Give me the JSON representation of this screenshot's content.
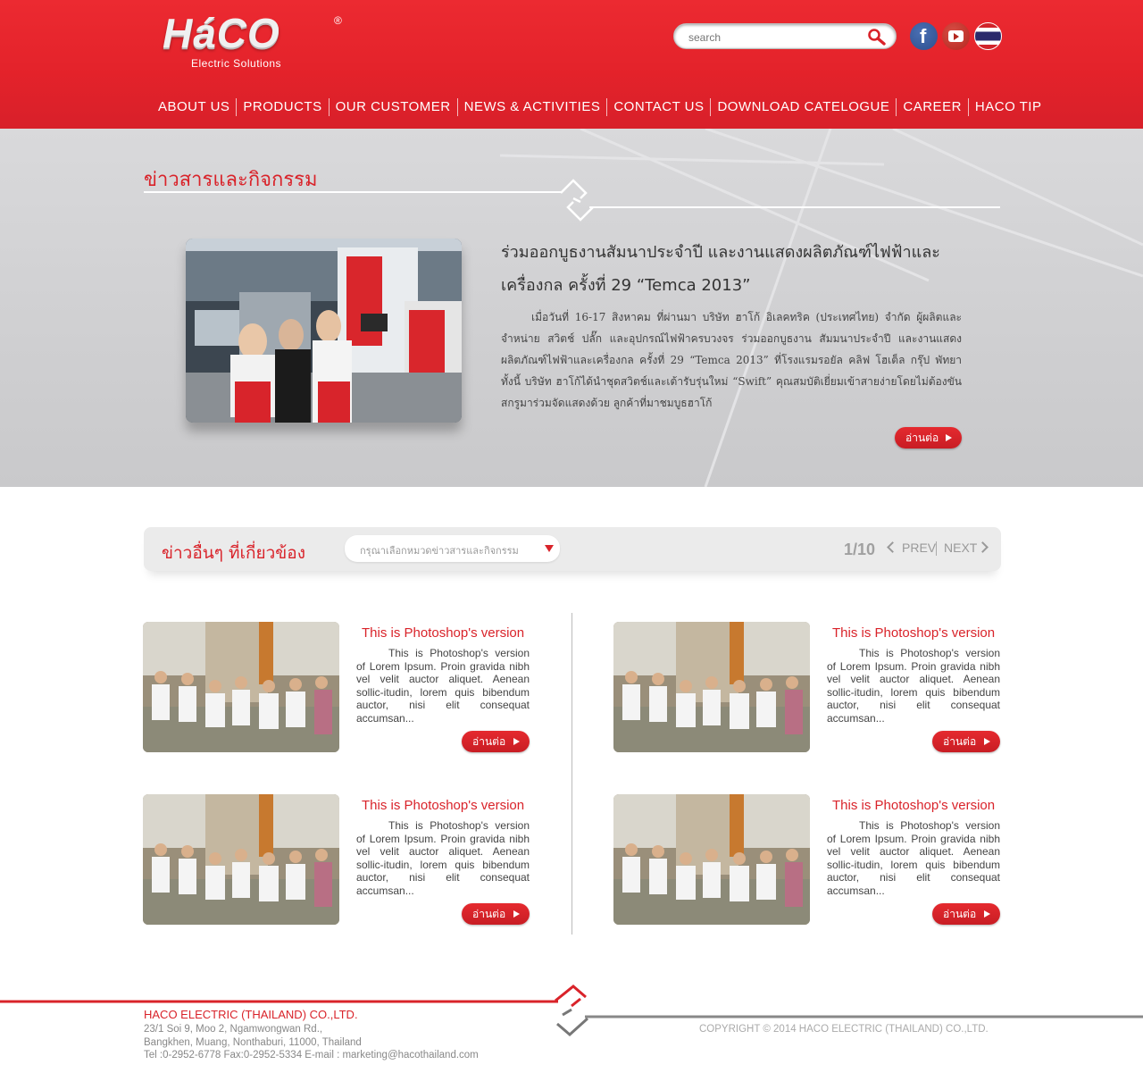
{
  "brand": {
    "logo_text": "HáCO",
    "reg_mark": "®",
    "tagline": "Electric Solutions"
  },
  "search": {
    "placeholder": "search"
  },
  "social": {
    "facebook_glyph": "f"
  },
  "nav": [
    "ABOUT US",
    "PRODUCTS",
    "OUR CUSTOMER",
    "NEWS & ACTIVITIES",
    "CONTACT US",
    "DOWNLOAD CATELOGUE",
    "CAREER",
    "HACO TIP"
  ],
  "hero": {
    "section_title": "ข่าวสารและกิจกรรม",
    "featured_title": "ร่วมออกบูธงานสัมนาประจำปี และงานแสดงผลิตภัณฑ์ไฟฟ้าและเครื่องกล ครั้งที่ 29 “Temca 2013”",
    "featured_body": "เมื่อวันที่ 16-17 สิงหาคม ที่ผ่านมา บริษัท ฮาโก้ อิเลคทริค (ประเทศไทย) จำกัด ผู้ผลิตและจำหน่าย สวิตช์ ปลั๊ก และอุปกรณ์ไฟฟ้าครบวงจร ร่วมออกบูธงาน สัมมนาประจำปี และงานแสดงผลิตภัณฑ์ไฟฟ้าและเครื่องกล ครั้งที่ 29 “Temca 2013” ที่โรงแรมรอยัล คลิฟ โฮเต็ล กรุ๊ป พัทยา ทั้งนี้ บริษัท ฮาโก้ได้นำชุดสวิตช์และเต้ารับรุ่นใหม่ “Swift” คุณสมบัติเยี่ยมเข้าสายง่ายโดยไม่ต้องขันสกรูมาร่วมจัดแสดงด้วย ลูกค้าที่มาชมบูธฮาโก้",
    "read_more": "อ่านต่อ"
  },
  "related": {
    "title": "ข่าวอื่นๆ ที่เกี่ยวข้อง",
    "select_placeholder": "กรุณาเลือกหมวดข่าวสารและกิจกรรม",
    "page": "1/10",
    "prev": "PREV",
    "next": "NEXT",
    "items": [
      {
        "title": "This is Photoshop's version",
        "body": "This is Photoshop's version of Lorem Ipsum. Proin gravida nibh vel velit auctor aliquet. Aenean sollic-itudin, lorem quis bibendum auctor, nisi elit consequat accumsan...",
        "read_more": "อ่านต่อ"
      },
      {
        "title": "This is Photoshop's version",
        "body": "This is Photoshop's version of Lorem Ipsum. Proin gravida nibh vel velit auctor aliquet. Aenean sollic-itudin, lorem quis bibendum auctor, nisi elit consequat accumsan...",
        "read_more": "อ่านต่อ"
      },
      {
        "title": "This is Photoshop's version",
        "body": "This is Photoshop's version of Lorem Ipsum. Proin gravida nibh vel velit auctor aliquet. Aenean sollic-itudin, lorem quis bibendum auctor, nisi elit consequat accumsan...",
        "read_more": "อ่านต่อ"
      },
      {
        "title": "This is Photoshop's version",
        "body": "This is Photoshop's version of Lorem Ipsum. Proin gravida nibh vel velit auctor aliquet. Aenean sollic-itudin, lorem quis bibendum auctor, nisi elit consequat accumsan...",
        "read_more": "อ่านต่อ"
      }
    ]
  },
  "footer": {
    "company": "HACO ELECTRIC (THAILAND) CO.,LTD.",
    "address_1": "23/1 Soi 9, Moo 2, Ngamwongwan Rd.,",
    "address_2": "Bangkhen, Muang, Nonthaburi, 11000, Thailand",
    "contact": "Tel :0-2952-6778 Fax:0-2952-5334 E-mail : marketing@hacothailand.com",
    "copyright": "COPYRIGHT © 2014 HACO ELECTRIC (THAILAND) CO.,LTD."
  },
  "colors": {
    "brand_red": "#e8232b",
    "hero_bg": "#d2d2d4",
    "text_gray": "#888888"
  },
  "icons": [
    "search-icon",
    "facebook-icon",
    "youtube-icon",
    "thai-flag-icon",
    "plug-icon",
    "chevron-left-icon",
    "chevron-right-icon",
    "dropdown-arrow-icon",
    "play-arrow-icon"
  ]
}
